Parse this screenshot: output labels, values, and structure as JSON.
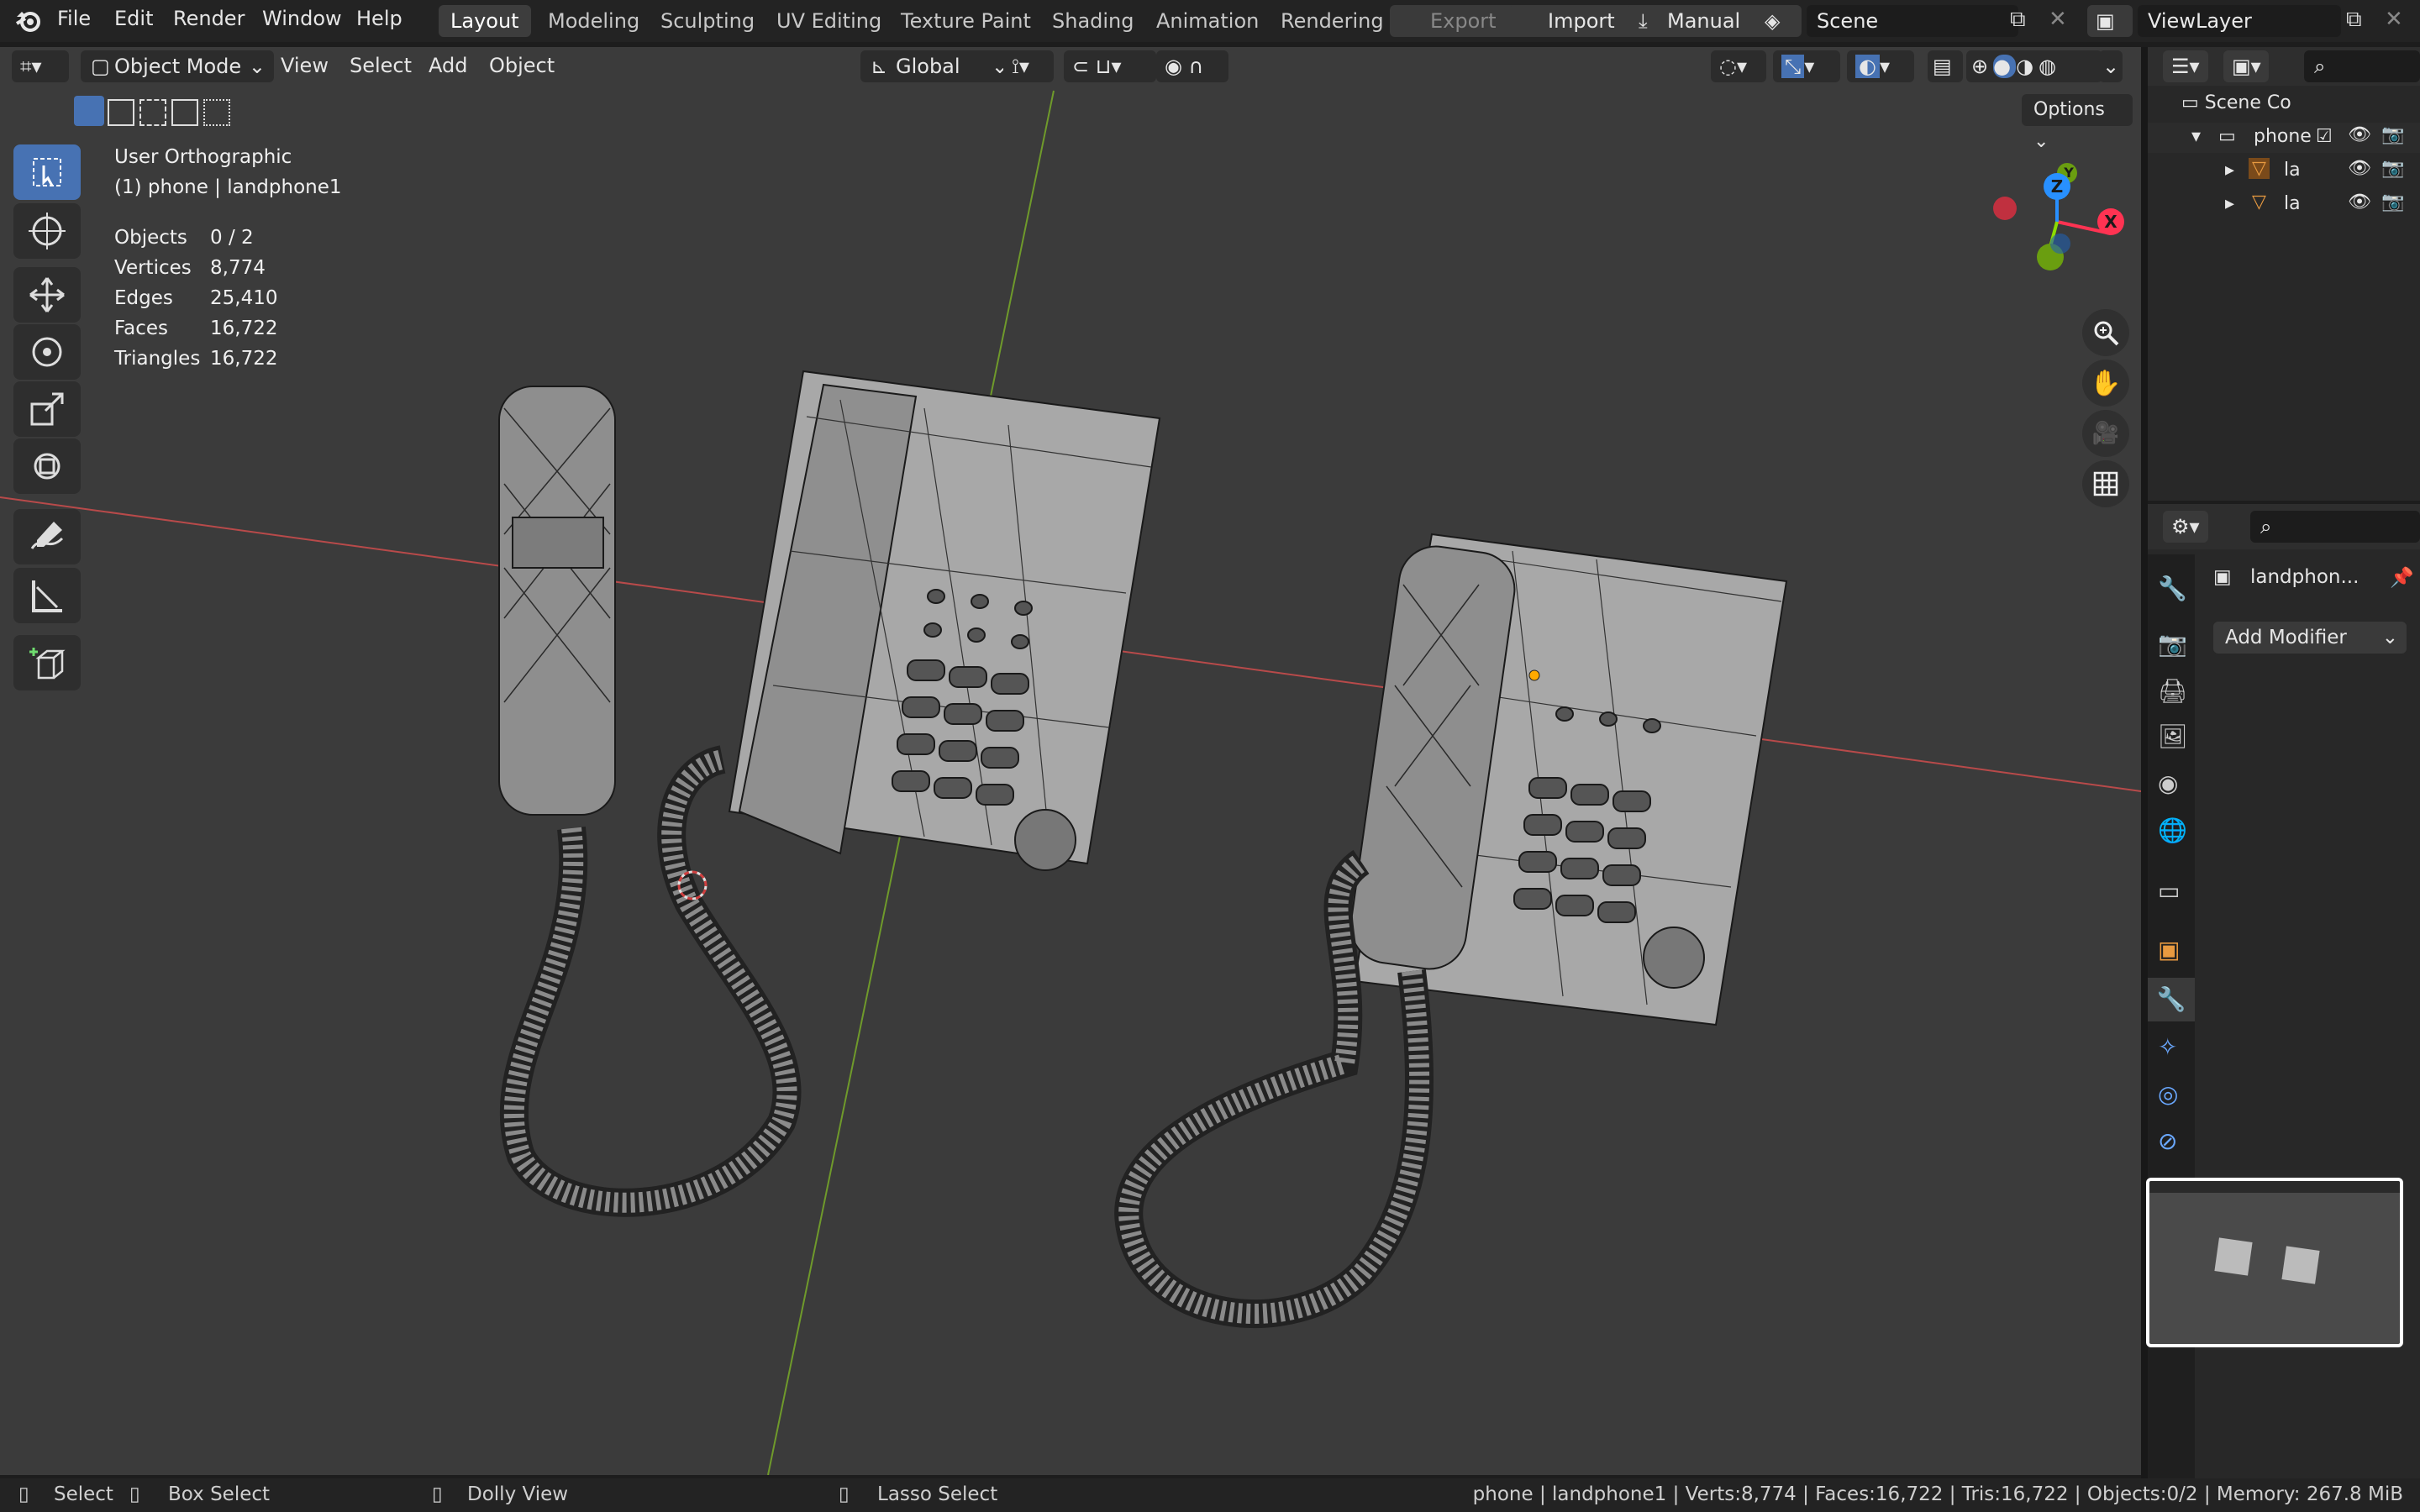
{
  "app": {
    "menus": [
      "File",
      "Edit",
      "Render",
      "Window",
      "Help"
    ],
    "workspaces": [
      "Layout",
      "Modeling",
      "Sculpting",
      "UV Editing",
      "Texture Paint",
      "Shading",
      "Animation",
      "Rendering"
    ],
    "active_workspace": "Layout",
    "header_buttons": {
      "export": "Export",
      "import": "Import",
      "manual": "Manual"
    },
    "scene": "Scene",
    "view_layer": "ViewLayer"
  },
  "viewport_header": {
    "mode": "Object Mode",
    "menus": [
      "View",
      "Select",
      "Add",
      "Object"
    ],
    "transform_orientation": "Global",
    "options": "Options"
  },
  "viewport_info": {
    "view_name": "User Orthographic",
    "context": "(1) phone | landphone1",
    "stats": [
      {
        "label": "Objects",
        "value": "0 / 2"
      },
      {
        "label": "Vertices",
        "value": "8,774"
      },
      {
        "label": "Edges",
        "value": "25,410"
      },
      {
        "label": "Faces",
        "value": "16,722"
      },
      {
        "label": "Triangles",
        "value": "16,722"
      }
    ]
  },
  "gizmo": {
    "x": "X",
    "y": "Y",
    "z": "Z"
  },
  "outliner": {
    "scene_collection": "Scene Co",
    "collection": "phone",
    "items": [
      "la",
      "la"
    ]
  },
  "properties": {
    "object_name": "landphon...",
    "add_modifier": "Add Modifier"
  },
  "statusbar": {
    "select": "Select",
    "box_select": "Box Select",
    "dolly_view": "Dolly View",
    "lasso_select": "Lasso Select",
    "info": "phone | landphone1 | Verts:8,774 | Faces:16,722 | Tris:16,722 | Objects:0/2 | Memory: 267.8 MiB"
  },
  "colors": {
    "accent": "#4772b3",
    "x_axis": "#ff3352",
    "y_axis": "#8bdc00",
    "z_axis": "#2890ff",
    "viewport_bg": "#3b3b3b",
    "object_origin": "#ffaa00"
  }
}
